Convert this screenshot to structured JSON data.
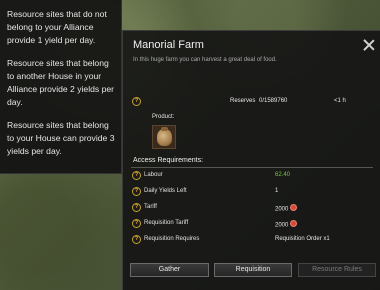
{
  "tooltip": {
    "lines": [
      "Resource sites that do not belong to your Alliance provide 1 yield per day.",
      "Resource sites that belong to another House in your Alliance provide 2 yields per day.",
      "Resource sites that belong to your House can provide 3 yields per day."
    ]
  },
  "panel": {
    "title": "Manorial Farm",
    "description": "In this huge farm you can harvest a great deal of food.",
    "reserves_label": "Reserves",
    "reserves_value": "0/1589760",
    "reserves_time": "<1 h",
    "product_label": "Product:",
    "access_title": "Access Requirements:",
    "rows": [
      {
        "label": "Labour",
        "value": "62.40",
        "color": "#7ac24a"
      },
      {
        "label": "Daily Yields Left",
        "value": "1"
      },
      {
        "label": "Tariff",
        "value": "2000",
        "currency_icon": "coin-icon"
      },
      {
        "label": "Requisition Tariff",
        "value": "2000",
        "currency_icon": "coin-icon"
      },
      {
        "label": "Requisition Requires",
        "value": "Requisition Order x1"
      }
    ],
    "buttons": {
      "gather": "Gather",
      "requisition": "Requisition",
      "resource_rules": "Resource Rules"
    }
  }
}
